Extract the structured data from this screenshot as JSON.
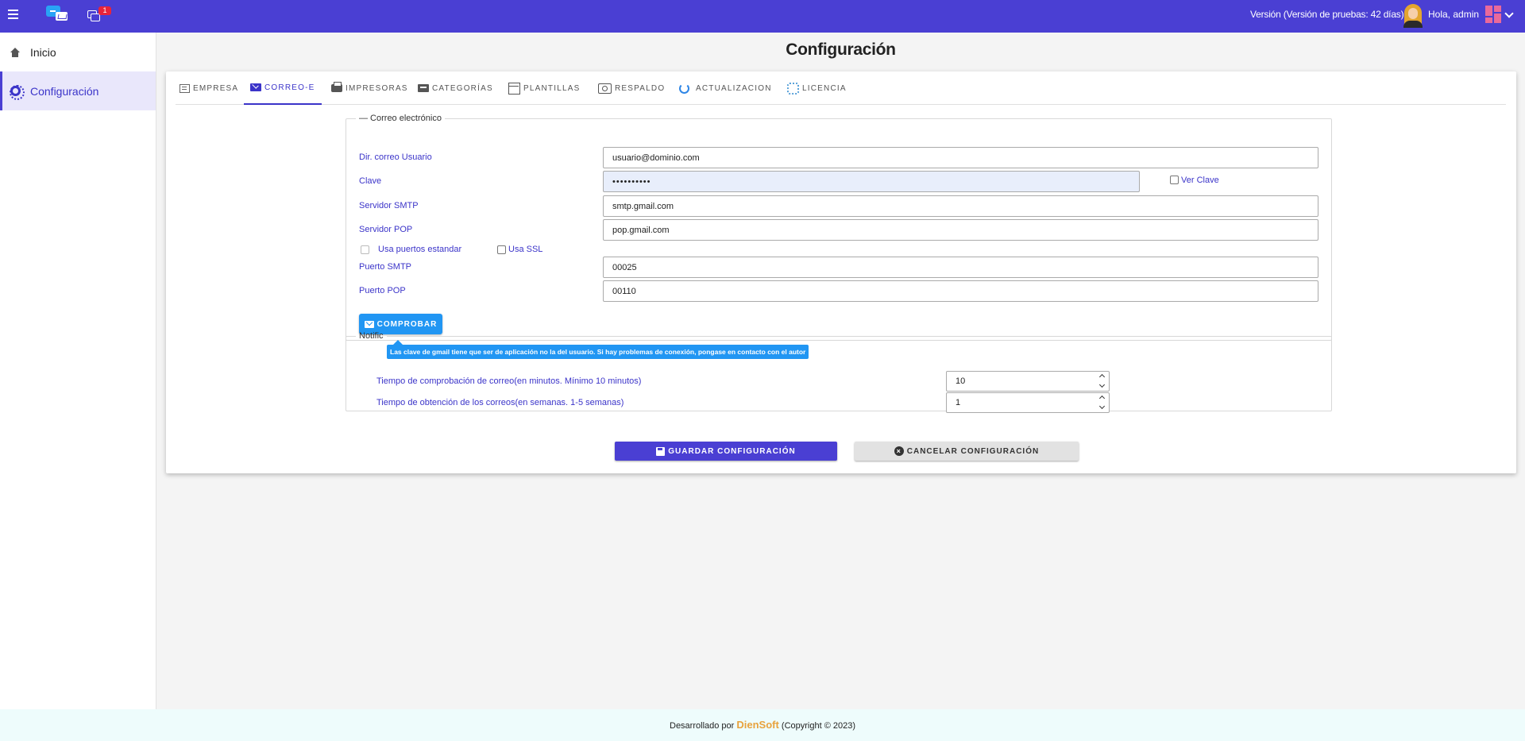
{
  "topbar": {
    "notification_count": "1",
    "version_text": "Versión (Versión de pruebas: 42 días)",
    "greeting": "Hola, admin",
    "bar_color": "#4a3fd3"
  },
  "sidebar": {
    "items": [
      {
        "label": "Inicio",
        "icon": "home-icon"
      },
      {
        "label": "Configuración",
        "icon": "gear-icon",
        "active": true
      }
    ]
  },
  "page": {
    "title": "Configuración"
  },
  "tabs": [
    {
      "label": "EMPRESA",
      "icon": "building-icon"
    },
    {
      "label": "CORREO-E",
      "icon": "mail-icon",
      "active": true
    },
    {
      "label": "IMPRESORAS",
      "icon": "printer-icon"
    },
    {
      "label": "CATEGORÍAS",
      "icon": "folder-icon"
    },
    {
      "label": "PLANTILLAS",
      "icon": "template-icon"
    },
    {
      "label": "RESPALDO",
      "icon": "backup-icon"
    },
    {
      "label": "ACTUALIZACION",
      "icon": "refresh-icon"
    },
    {
      "label": "LICENCIA",
      "icon": "license-icon"
    }
  ],
  "email": {
    "legend": "— Correo electrónico",
    "user_label": "Dir. correo Usuario",
    "user_value": "usuario@dominio.com",
    "password_label": "Clave",
    "password_value": "••••••••••",
    "show_password_label": "Ver Clave",
    "smtp_label": "Servidor SMTP",
    "smtp_value": "smtp.gmail.com",
    "pop_label": "Servidor POP",
    "pop_value": "pop.gmail.com",
    "standard_ports_label": "Usa puertos estandar",
    "ssl_label": "Usa SSL",
    "smtp_port_label": "Puerto SMTP",
    "smtp_port_value": "00025",
    "pop_port_label": "Puerto POP",
    "pop_port_value": "00110",
    "check_button": "COMPROBAR"
  },
  "tooltip": "Las clave de gmail tiene que ser de aplicación no la del usuario. Si hay problemas de conexión, pongase en contacto con el autor",
  "notifications": {
    "legend": "Notific",
    "check_time_label": "Tiempo de comprobación de correo(en minutos. Mínimo 10 minutos)",
    "check_time_value": "10",
    "fetch_time_label": "Tiempo de obtención de los correos(en semanas. 1-5 semanas)",
    "fetch_time_value": "1"
  },
  "actions": {
    "save": "GUARDAR CONFIGURACIÓN",
    "cancel": "CANCELAR CONFIGURACIÓN"
  },
  "footer": {
    "prefix": "Desarrollado por",
    "brand": "DienSoft",
    "suffix": "(Copyright © 2023)"
  }
}
